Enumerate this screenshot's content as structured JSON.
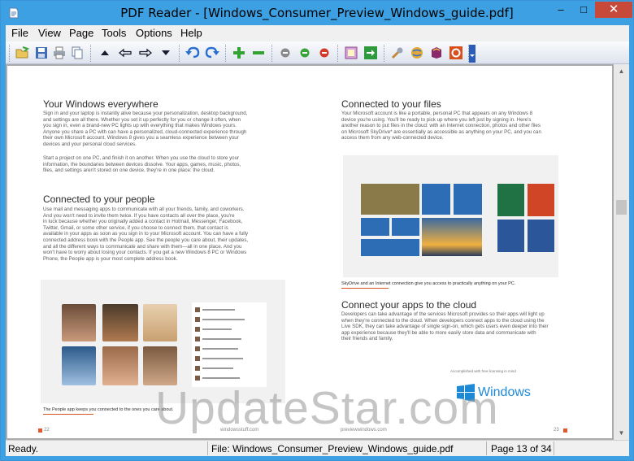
{
  "window": {
    "title": "PDF Reader - [Windows_Consumer_Preview_Windows_guide.pdf]",
    "min_glyph": "–",
    "max_glyph": "□",
    "close_glyph": "✕"
  },
  "menu": [
    "File",
    "View",
    "Page",
    "Tools",
    "Options",
    "Help"
  ],
  "toolbar": {
    "items": [
      "open-icon",
      "save-icon",
      "print-icon",
      "copy-icon",
      "first-page-icon",
      "previous-page-icon",
      "next-page-icon",
      "last-page-icon",
      "undo-icon",
      "redo-icon",
      "zoom-in-icon",
      "zoom-out-icon",
      "gray-circle-icon",
      "green-circle-icon",
      "red-circle-icon",
      "page-view-icon",
      "go-arrow-icon",
      "tools-icon",
      "web-icon",
      "book-icon",
      "info-icon"
    ]
  },
  "document": {
    "left": {
      "h1": "Your Windows everywhere",
      "p1": [
        "Sign in and your laptop is instantly alive because your personalization, desktop background,",
        "and settings are all there. Whether you set it up perfectly for you or change it often, when",
        "you sign in, even a brand-new PC lights up with everything that makes Windows yours.",
        "Anyone you share a PC with can have a personalized, cloud-connected experience through",
        "their own Microsoft account. Windows 8 gives you a seamless experience between your",
        "devices and your personal cloud services."
      ],
      "p2": [
        "Start a project on one PC, and finish it on another. When you use the cloud to store your",
        "information, the boundaries between devices dissolve. Your apps, games, music, photos,",
        "files, and settings aren't stored on one device, they're in one place: the cloud."
      ],
      "h2": "Connected to your people",
      "p3": [
        "Use mail and messaging apps to communicate with all your friends, family, and coworkers.",
        "And you won't need to invite them twice. If you have contacts all over the place, you're",
        "in luck because whether you originally added a contact in Hotmail, Messenger, Facebook,",
        "Twitter, Gmail, or some other service, if you choose to connect them, that contact is",
        "available in your apps as soon as you sign in to your Microsoft account. You can have a fully",
        "connected address book with the People app. See the people you care about, their updates,",
        "and all the different ways to communicate and share with them—all in one place. And you",
        "won't have to worry about losing your contacts. If you get a new Windows 8 PC or Windows",
        "Phone, the People app is your most complete address book."
      ],
      "caption": "The People app keeps you connected to the ones you care about.",
      "page_num": "22",
      "footer": "windowsstuff.com"
    },
    "right": {
      "h1": "Connected to your files",
      "p1": [
        "Your Microsoft account is like a portable, personal PC that appears on any Windows 8",
        "device you're using. You'll be ready to pick up where you left just by signing in. Here's",
        "another reason to put files in the cloud: with an Internet connection, photos and other files",
        "on Microsoft SkyDrive* are essentially as accessible as anything on your PC, and you can",
        "access them from any web-connected device."
      ],
      "caption": "SkyDrive and an Internet connection give you access to practically anything on your PC.",
      "h2": "Connect your apps to the cloud",
      "p2": [
        "Developers can take advantage of the services Microsoft provides so their apps will light up",
        "when they're connected to the cloud. When developers connect apps to the cloud using the",
        "Live SDK, they can take advantage of single sign-on, which gets users even deeper into their",
        "app experience because they'll be able to more easily store data and communicate with",
        "their friends and family."
      ],
      "logo_small": "Accomplished with free licensing in mind",
      "logo_text": "Windows",
      "page_num": "23",
      "footer": "previewwindows.com"
    }
  },
  "watermark": "UpdateStar.com",
  "status": {
    "ready": "Ready.",
    "file": "File: Windows_Consumer_Preview_Windows_guide.pdf",
    "page": "Page 13 of 34"
  },
  "colors": {
    "title_bar": "#3da0e2",
    "close": "#c7493a",
    "accent": "#e2582c"
  }
}
